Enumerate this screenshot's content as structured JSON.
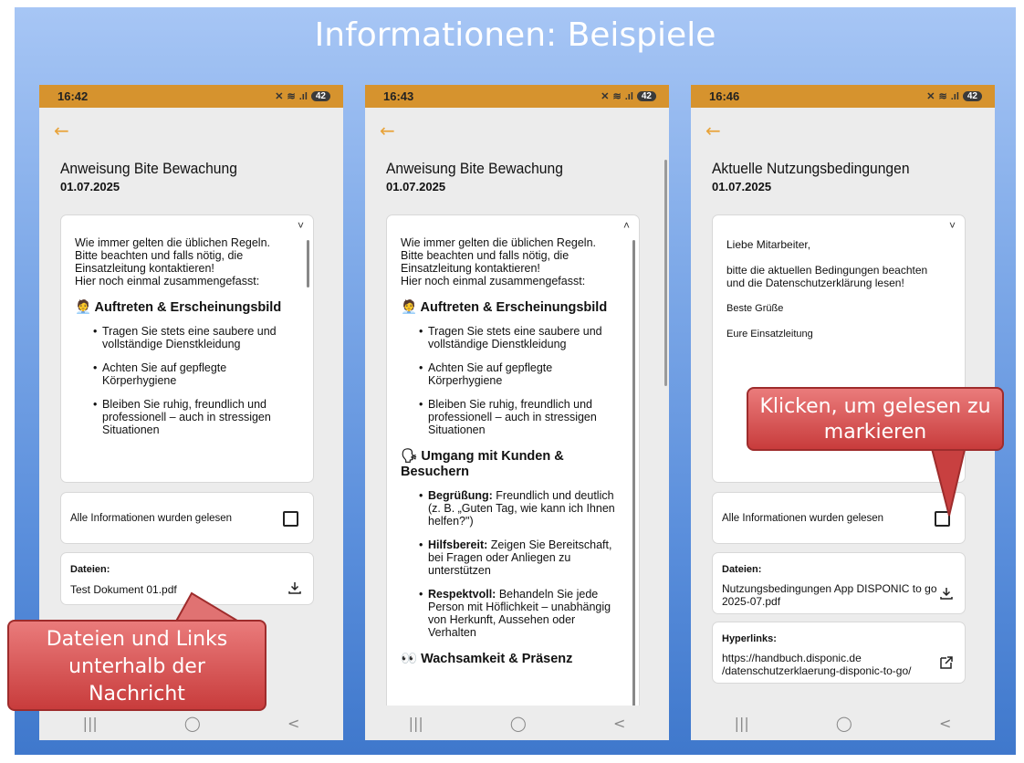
{
  "slide": {
    "title": "Informationen: Beispiele"
  },
  "phones": [
    {
      "time": "16:42",
      "battery": "42",
      "title": "Anweisung Bite Bewachung",
      "date": "01.07.2025",
      "chevron": "˅",
      "intro": [
        "Wie immer gelten die üblichen Regeln.",
        "Bitte beachten und falls nötig, die",
        "Einsatzleitung kontaktieren!",
        "Hier noch einmal zusammengefasst:"
      ],
      "section1": "🧑‍💼 Auftreten & Erscheinungsbild",
      "bullets": [
        "Tragen Sie stets eine saubere und vollständige Dienstkleidung",
        "Achten Sie auf gepflegte Körperhygiene",
        "Bleiben Sie ruhig, freundlich und professionell – auch in stressigen Situationen"
      ],
      "read_label": "Alle Informationen wurden gelesen",
      "files_label": "Dateien:",
      "file_name": "Test Dokument 01.pdf"
    },
    {
      "time": "16:43",
      "battery": "42",
      "title": "Anweisung Bite Bewachung",
      "date": "01.07.2025",
      "chevron": "˄",
      "intro": [
        "Wie immer gelten die üblichen Regeln.",
        "Bitte beachten und falls nötig, die",
        "Einsatzleitung kontaktieren!",
        "Hier noch einmal zusammengefasst:"
      ],
      "section1": "🧑‍💼 Auftreten & Erscheinungsbild",
      "bullets": [
        "Tragen Sie stets eine saubere und vollständige Dienstkleidung",
        "Achten Sie auf gepflegte Körperhygiene",
        "Bleiben Sie ruhig, freundlich und professionell – auch in stressigen Situationen"
      ],
      "section2": "🗣 Umgang mit Kunden & Besuchern",
      "bullets2": [
        {
          "bold": "Begrüßung:",
          "text": " Freundlich und deutlich (z. B. „Guten Tag, wie kann ich Ihnen helfen?\")"
        },
        {
          "bold": "Hilfsbereit:",
          "text": " Zeigen Sie Bereitschaft, bei Fragen oder Anliegen zu unterstützen"
        },
        {
          "bold": "Respektvoll:",
          "text": " Behandeln Sie jede Person mit Höflichkeit – unabhängig von Herkunft, Aussehen oder Verhalten"
        }
      ],
      "section3": "👀 Wachsamkeit & Präsenz"
    },
    {
      "time": "16:46",
      "battery": "42",
      "title": "Aktuelle Nutzungsbedingungen",
      "date": "01.07.2025",
      "chevron": "˅",
      "greeting": "Liebe Mitarbeiter,",
      "body": [
        "bitte die aktuellen Bedingungen beachten",
        "und die Datenschutzerklärung lesen!"
      ],
      "regards": "Beste Grüße",
      "signature": "Eure Einsatzleitung",
      "read_label": "Alle Informationen wurden gelesen",
      "files_label": "Dateien:",
      "file_name": [
        "Nutzungsbedingungen App DISPONIC to go",
        "2025-07.pdf"
      ],
      "links_label": "Hyperlinks:",
      "link": [
        "https://handbuch.disponic.de",
        "/datenschutzerklaerung-disponic-to-go/"
      ]
    }
  ],
  "nav": {
    "recent": "|||",
    "home": "◯",
    "back": "<"
  },
  "callouts": {
    "mark_read": "Klicken, um gelesen zu markieren",
    "files_links": "Dateien und Links unterhalb der Nachricht"
  },
  "colors": {
    "status_bar": "#d6932e",
    "accent": "#e8a33a",
    "callout": "#d95555"
  }
}
